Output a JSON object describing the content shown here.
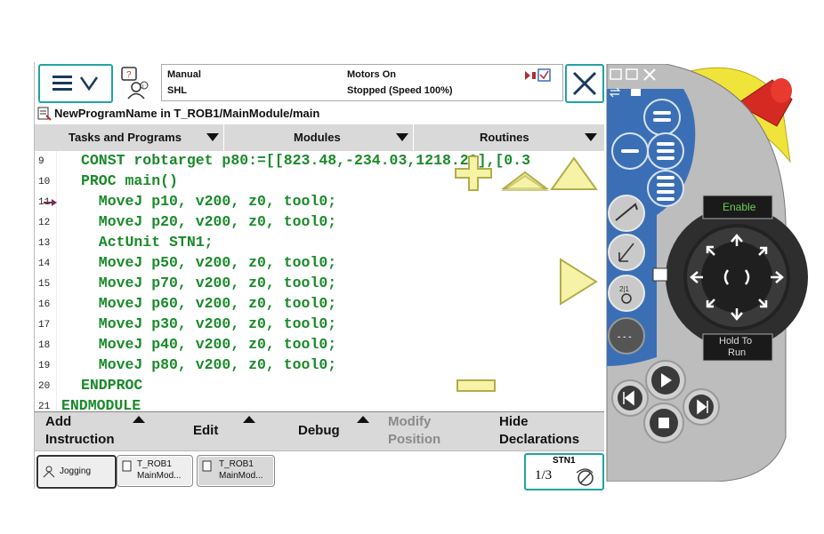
{
  "status": {
    "mode": "Manual",
    "system": "SHL",
    "motors": "Motors On",
    "state": "Stopped (Speed 100%)"
  },
  "window_title": "NewProgramName in T_ROB1/MainModule/main",
  "tabs": [
    {
      "label": "Tasks and Programs"
    },
    {
      "label": "Modules"
    },
    {
      "label": "Routines"
    }
  ],
  "code_lines": [
    {
      "num": "9",
      "text": "CONST robtarget p80:=[[823.48,-234.03,1218.23],[0.3"
    },
    {
      "num": "10",
      "text": "PROC main()"
    },
    {
      "num": "11",
      "text": "  MoveJ p10, v200, z0, tool0;"
    },
    {
      "num": "12",
      "text": "  MoveJ p20, v200, z0, tool0;"
    },
    {
      "num": "13",
      "text": "  ActUnit STN1;"
    },
    {
      "num": "14",
      "text": "  MoveJ p50, v200, z0, tool0;"
    },
    {
      "num": "15",
      "text": "  MoveJ p70, v200, z0, tool0;"
    },
    {
      "num": "16",
      "text": "  MoveJ p60, v200, z0, tool0;"
    },
    {
      "num": "17",
      "text": "  MoveJ p30, v200, z0, tool0;"
    },
    {
      "num": "18",
      "text": "  MoveJ p40, v200, z0, tool0;"
    },
    {
      "num": "19",
      "text": "  MoveJ p80, v200, z0, tool0;"
    },
    {
      "num": "20",
      "text": "ENDPROC"
    },
    {
      "num": "21",
      "text": "ENDMODULE"
    }
  ],
  "bottom_buttons": {
    "add_instruction": "Add\nInstruction",
    "edit": "Edit",
    "debug": "Debug",
    "modify_position": "Modify\nPosition",
    "hide_declarations": "Hide\nDeclarations"
  },
  "taskbar": {
    "jogging": "Jogging",
    "task1_line1": "T_ROB1",
    "task1_line2": "MainMod...",
    "task2_line1": "T_ROB1",
    "task2_line2": "MainMod...",
    "unit": "STN1",
    "unit_fraction": "1/3"
  },
  "device": {
    "enable_label": "Enable",
    "hold_to_run": "Hold To\nRun"
  },
  "colors": {
    "code_green": "#1a8a2a",
    "accent_teal": "#22a3a3",
    "overlay_yellow": "#f6f3a6",
    "device_blue": "#3b6fb5",
    "device_yellow": "#f0e43a"
  }
}
